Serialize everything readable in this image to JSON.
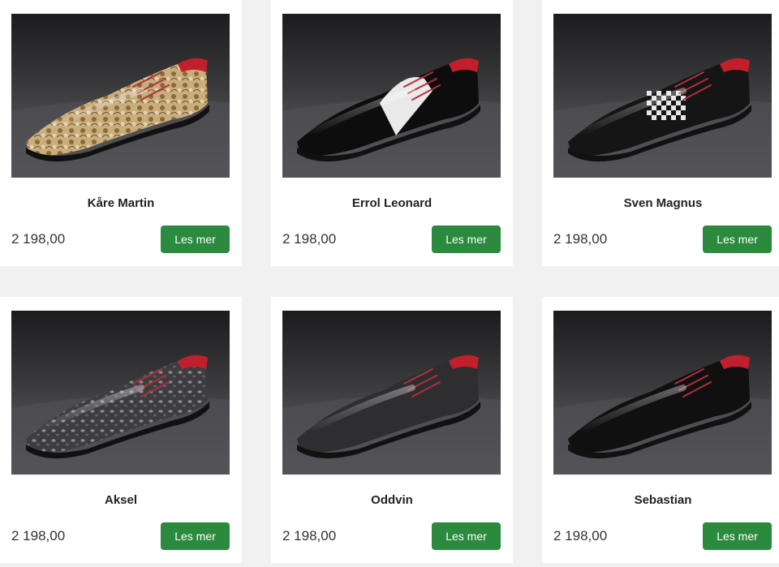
{
  "products": [
    {
      "name": "Kåre Martin",
      "price": "2 198,00",
      "button": "Les mer",
      "pattern": "paisley",
      "upper_color": "#b79a6a"
    },
    {
      "name": "Errol Leonard",
      "price": "2 198,00",
      "button": "Les mer",
      "pattern": "spectator",
      "upper_color": "#0d0d0d"
    },
    {
      "name": "Sven Magnus",
      "price": "2 198,00",
      "button": "Les mer",
      "pattern": "checker",
      "upper_color": "#151515"
    },
    {
      "name": "Aksel",
      "price": "2 198,00",
      "button": "Les mer",
      "pattern": "leopard",
      "upper_color": "#3b3b3f"
    },
    {
      "name": "Oddvin",
      "price": "2 198,00",
      "button": "Les mer",
      "pattern": "matte",
      "upper_color": "#2e2e31"
    },
    {
      "name": "Sebastian",
      "price": "2 198,00",
      "button": "Les mer",
      "pattern": "patent",
      "upper_color": "#101010"
    }
  ],
  "colors": {
    "button_bg": "#2b8a3e",
    "page_bg": "#f1f1f1",
    "card_bg": "#ffffff"
  }
}
